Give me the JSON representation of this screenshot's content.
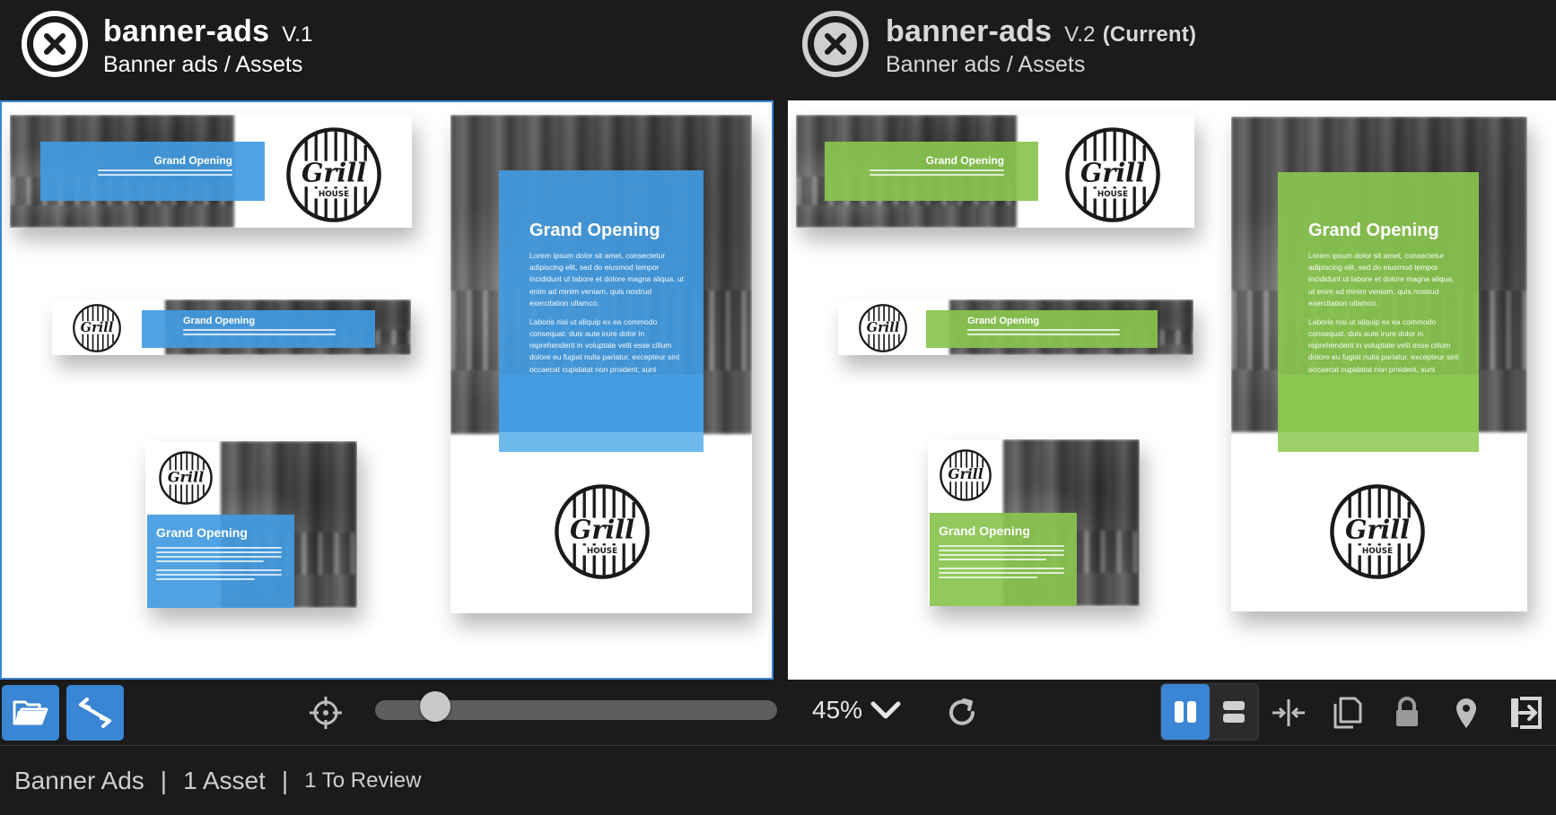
{
  "left": {
    "title": "banner-ads",
    "version": "V.1",
    "current_label": "",
    "path": "Banner ads / Assets",
    "accent": "#429adf"
  },
  "right": {
    "title": "banner-ads",
    "version": "V.2",
    "current_label": "(Current)",
    "path": "Banner ads / Assets",
    "accent": "#89c44e"
  },
  "ads": {
    "headline": "Grand Opening",
    "body_p1": "Lorem ipsum dolor sit amet, consectetur adipiscing elit, sed do eiusmod tempor incididunt ut labore et dolore magna aliqua. ut enim ad minim veniam, quis nostrud exercitation ullamco.",
    "body_p2": "Laboris nisi ut aliquip ex ea commodo consequat. duis aute irure dolor in reprehenderit in voluptate velit esse cillum dolore eu fugiat nulla pariatur. excepteur sint occaecat cupidatat non proident, sunt",
    "logo_word": "Grill",
    "logo_sub": "HOUSE"
  },
  "toolbar": {
    "zoom": "45%",
    "zoom_fraction": 0.12,
    "selection_color": "#3a85d4"
  },
  "status": {
    "project": "Banner Ads",
    "assets": "1 Asset",
    "review": "1 To Review"
  },
  "icons": {
    "close": "close-circle-icon",
    "folder": "folder-open-icon",
    "swap": "swap-arrows-icon",
    "crosshair": "crosshair-icon",
    "chevron": "chevron-down-icon",
    "refresh": "refresh-icon",
    "side_by_side": "side-by-side-view-icon",
    "stacked": "stacked-view-icon",
    "split": "split-compare-icon",
    "copy": "copy-pages-icon",
    "lock": "lock-icon",
    "pin": "location-pin-icon",
    "exit": "exit-icon"
  }
}
